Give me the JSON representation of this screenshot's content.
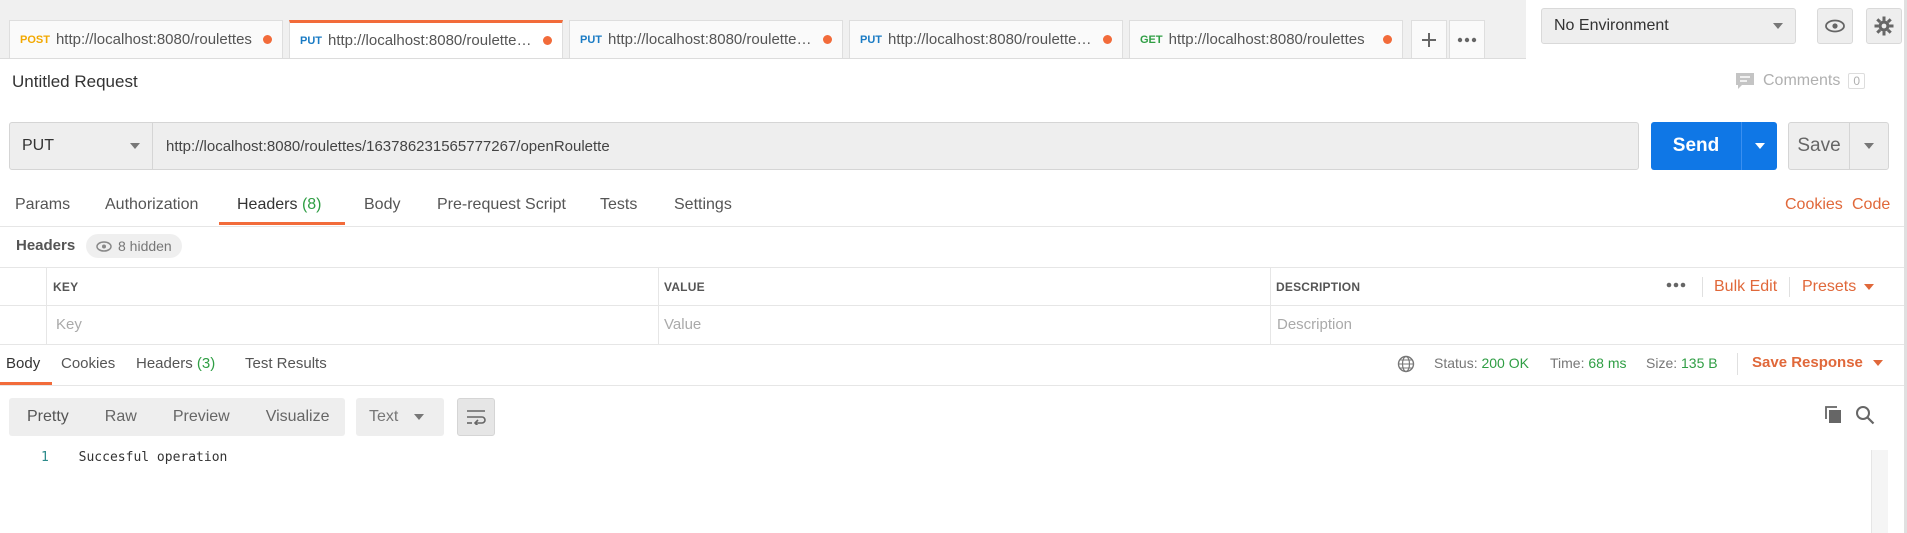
{
  "tabs": [
    {
      "method": "POST",
      "url": "http://localhost:8080/roulettes"
    },
    {
      "method": "PUT",
      "url": "http://localhost:8080/roulettes/..."
    },
    {
      "method": "PUT",
      "url": "http://localhost:8080/roulettes/..."
    },
    {
      "method": "PUT",
      "url": "http://localhost:8080/roulettes/..."
    },
    {
      "method": "GET",
      "url": "http://localhost:8080/roulettes"
    }
  ],
  "env": {
    "selected": "No Environment"
  },
  "request": {
    "title": "Untitled Request",
    "comments_label": "Comments",
    "comments_count": "0",
    "method": "PUT",
    "url": "http://localhost:8080/roulettes/163786231565777267/openRoulette",
    "send_label": "Send",
    "save_label": "Save"
  },
  "request_tabs": {
    "params": "Params",
    "authorization": "Authorization",
    "headers": "Headers",
    "headers_count": "(8)",
    "body": "Body",
    "prerequest": "Pre-request Script",
    "tests": "Tests",
    "settings": "Settings",
    "cookies": "Cookies",
    "code": "Code"
  },
  "headers_section": {
    "label": "Headers",
    "hidden": "8 hidden",
    "col_key": "KEY",
    "col_value": "VALUE",
    "col_description": "DESCRIPTION",
    "bulk_edit": "Bulk Edit",
    "presets": "Presets",
    "ph_key": "Key",
    "ph_value": "Value",
    "ph_description": "Description"
  },
  "response_tabs": {
    "body": "Body",
    "cookies": "Cookies",
    "headers": "Headers",
    "headers_count": "(3)",
    "test_results": "Test Results"
  },
  "response_meta": {
    "status_label": "Status:",
    "status_value": "200 OK",
    "time_label": "Time:",
    "time_value": "68 ms",
    "size_label": "Size:",
    "size_value": "135 B",
    "save_response": "Save Response"
  },
  "view": {
    "pretty": "Pretty",
    "raw": "Raw",
    "preview": "Preview",
    "visualize": "Visualize",
    "format": "Text"
  },
  "response_body": {
    "line_number": "1",
    "text": "Succesful operation"
  },
  "colors": {
    "accent": "#f26b3a",
    "send": "#0f77e6",
    "success": "#2f9e44"
  }
}
